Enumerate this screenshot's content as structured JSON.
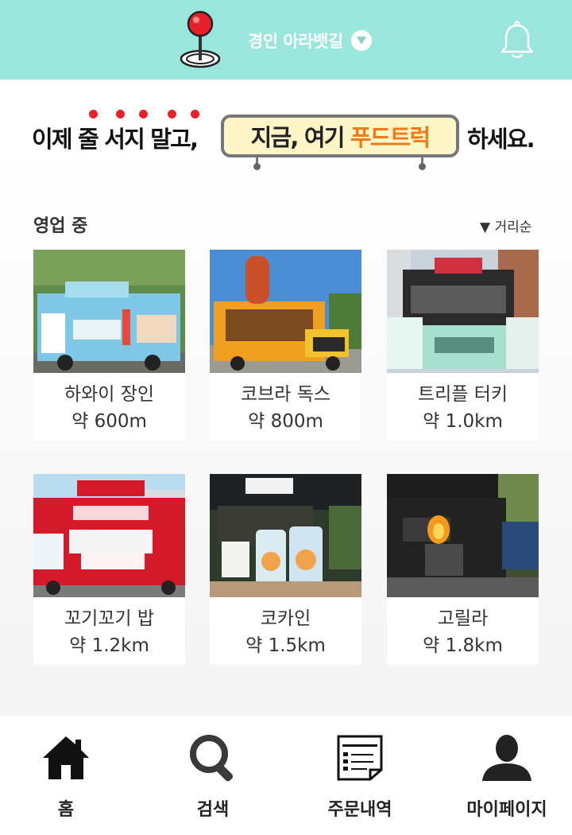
{
  "header": {
    "location": "경인 아라뱃길",
    "pin_icon": "map-pin-icon",
    "dropdown_icon": "chevron-down-icon",
    "bell_icon": "bell-icon",
    "accent_color": "#9be6dc"
  },
  "banner": {
    "left_text": "이제 줄 서지 말고,",
    "box_prefix": "지금, 여기 ",
    "box_highlight": "푸드트럭",
    "right_text": "하세요.",
    "highlight_color": "#f07a1a"
  },
  "section": {
    "title": "영업 중",
    "sort_label": "▼ 거리순"
  },
  "trucks": [
    {
      "name": "하와이 장인",
      "distance": "약 600m"
    },
    {
      "name": "코브라 독스",
      "distance": "약 800m"
    },
    {
      "name": "트리플 터키",
      "distance": "약 1.0km"
    },
    {
      "name": "꼬기꼬기 밥",
      "distance": "약 1.2km"
    },
    {
      "name": "코카인",
      "distance": "약 1.5km"
    },
    {
      "name": "고릴라",
      "distance": "약 1.8km"
    }
  ],
  "nav": [
    {
      "label": "홈",
      "icon": "home-icon"
    },
    {
      "label": "검색",
      "icon": "search-icon"
    },
    {
      "label": "주문내역",
      "icon": "order-list-icon"
    },
    {
      "label": "마이페이지",
      "icon": "user-icon"
    }
  ]
}
